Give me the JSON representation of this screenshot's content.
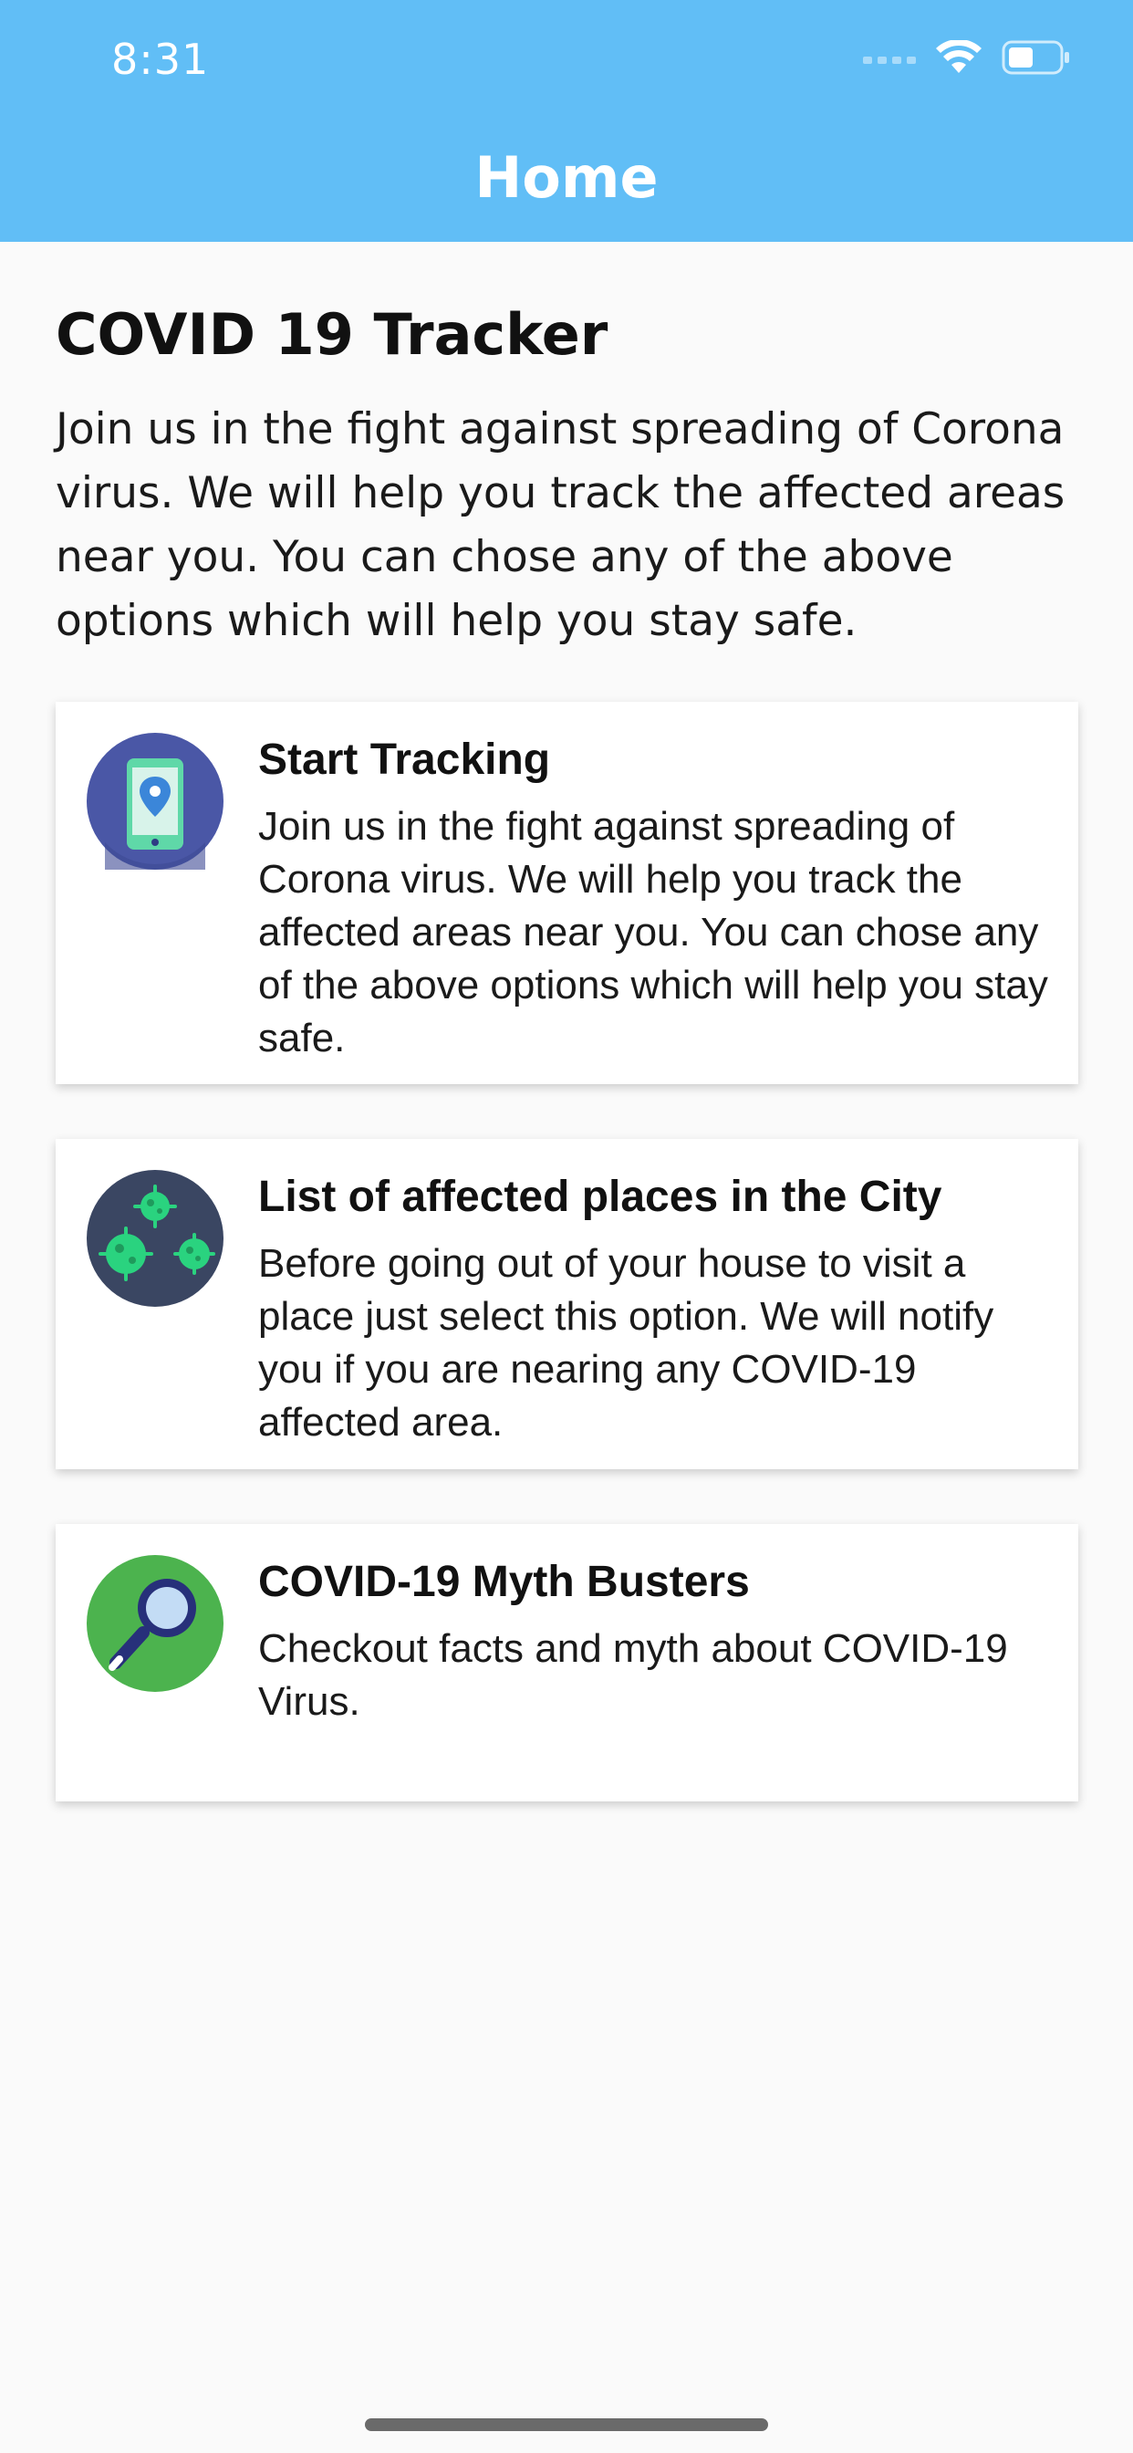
{
  "status_bar": {
    "time": "8:31"
  },
  "nav": {
    "title": "Home"
  },
  "intro": {
    "title": "COVID 19 Tracker",
    "text": "Join us in the fight against spreading of Corona virus. We will help you track the affected areas near you. You can chose any of the above options which will help you stay safe."
  },
  "cards": [
    {
      "title": "Start Tracking",
      "description": "Join us in the fight against spreading of Corona virus. We will help you track the affected areas near you. You can chose any of the above options which will help you stay safe.",
      "icon": "phone-location-icon"
    },
    {
      "title": "List of affected places in the City",
      "description": "Before going out of your house to visit a place just select this option. We will notify you if you are nearing any COVID-19 affected area.",
      "icon": "virus-icon"
    },
    {
      "title": "COVID-19 Myth Busters",
      "description": "Checkout facts and myth about COVID-19 Virus.",
      "icon": "magnifier-icon"
    }
  ],
  "colors": {
    "header": "#61bef6",
    "background": "#fafafa",
    "card": "#ffffff"
  }
}
